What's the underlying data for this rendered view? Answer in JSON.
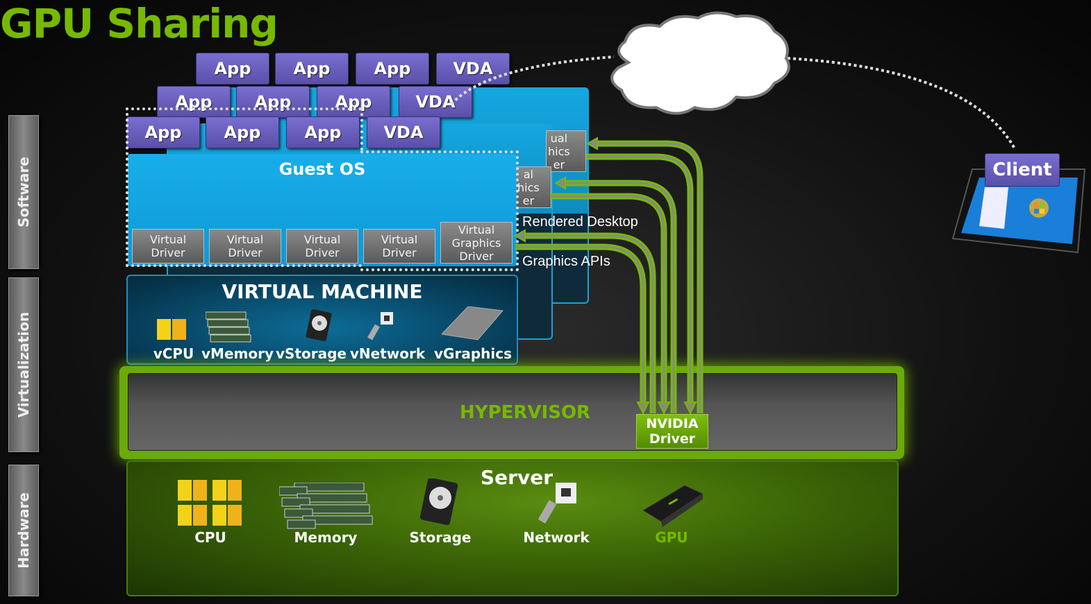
{
  "title": "GPU Sharing",
  "layers": {
    "software": "Software",
    "virtualization": "Virtualization",
    "hardware": "Hardware"
  },
  "vm_stack": [
    {
      "apps": [
        "App",
        "App",
        "App",
        "VDA"
      ]
    },
    {
      "apps": [
        "App",
        "App",
        "App",
        "VDA"
      ]
    },
    {
      "apps": [
        "App",
        "App",
        "App",
        "VDA"
      ]
    }
  ],
  "back_driver_fragments": [
    "ual\nhics\ner",
    "al\nhics\ner"
  ],
  "guest_os": {
    "title": "Guest OS",
    "drivers": [
      "Virtual\nDriver",
      "Virtual\nDriver",
      "Virtual\nDriver",
      "Virtual\nDriver",
      "Virtual\nGraphics\nDriver"
    ]
  },
  "virtual_machine": {
    "title": "VIRTUAL MACHINE",
    "resources": [
      "vCPU",
      "vMemory",
      "vStorage",
      "vNetwork",
      "vGraphics"
    ]
  },
  "flow_labels": {
    "rendered": "Rendered Desktop",
    "apis": "Graphics APIs"
  },
  "hypervisor": {
    "label": "HYPERVISOR",
    "driver": "NVIDIA\nDriver"
  },
  "server": {
    "title": "Server",
    "resources": [
      {
        "label": "CPU",
        "color": "#ffffff"
      },
      {
        "label": "Memory",
        "color": "#ffffff"
      },
      {
        "label": "Storage",
        "color": "#ffffff"
      },
      {
        "label": "Network",
        "color": "#ffffff"
      },
      {
        "label": "GPU",
        "color": "#76b900"
      }
    ]
  },
  "client": {
    "label": "Client"
  },
  "colors": {
    "brand": "#76b900",
    "app": "#6a5fc0",
    "vm": "#0d98d6"
  }
}
